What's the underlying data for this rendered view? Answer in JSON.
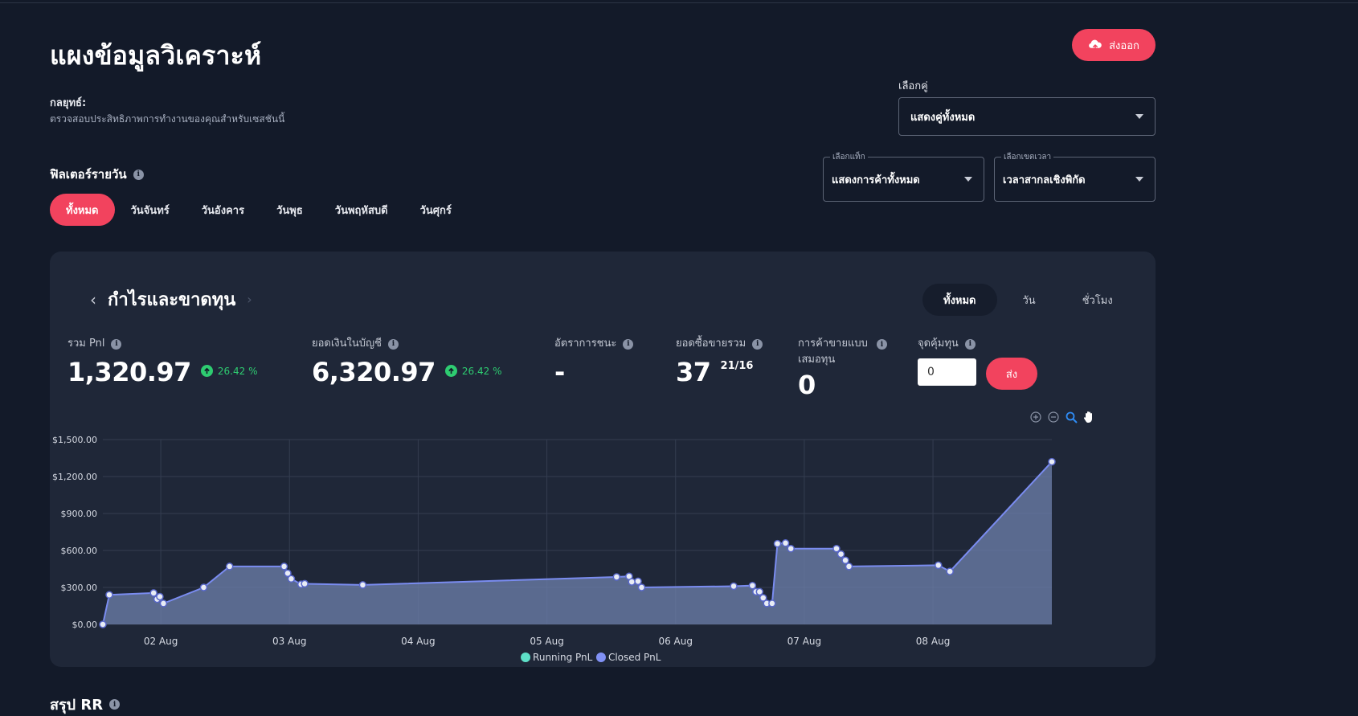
{
  "page": {
    "title": "แผงข้อมูลวิเคราะห์",
    "strategy_label": "กลยุทธ์:",
    "strategy_desc": "ตรวจสอบประสิทธิภาพการทำงานของคุณสำหรับเซสชันนี้",
    "export_label": "ส่งออก"
  },
  "filters": {
    "pair_label": "เลือกคู่",
    "pair_value": "แสดงคู่ทั้งหมด",
    "tag_legend": "เลือกแท็ก",
    "tag_value": "แสดงการค้าทั้งหมด",
    "tz_legend": "เลือกเขตเวลา",
    "tz_value": "เวลาสากลเชิงพิกัด",
    "daily_title": "ฟิลเตอร์รายวัน",
    "days": [
      "ทั้งหมด",
      "วันจันทร์",
      "วันอังคาร",
      "วันพุธ",
      "วันพฤหัสบดี",
      "วันศุกร์"
    ],
    "active_day": 0
  },
  "card": {
    "title": "กำไรและขาดทุน",
    "range_tabs": [
      "ทั้งหมด",
      "วัน",
      "ชั่วโมง"
    ],
    "active_range": 0,
    "stats": {
      "total_pnl": {
        "label": "รวม Pnl",
        "value": "1,320.97",
        "delta": "26.42 %"
      },
      "balance": {
        "label": "ยอดเงินในบัญชี",
        "value": "6,320.97",
        "delta": "26.42 %"
      },
      "win_rate": {
        "label": "อัตราการชนะ",
        "value": "-"
      },
      "total_trades": {
        "label": "ยอดซื้อขายรวม",
        "value": "37",
        "sub": "21/16"
      },
      "breakeven_trades": {
        "label": "การค้าขายแบบเสมอทุน",
        "value": "0"
      },
      "breakeven": {
        "label": "จุดคุ้มทุน",
        "input_value": "0",
        "submit_label": "ส่ง"
      }
    }
  },
  "chart_data": {
    "type": "area",
    "y_tick_labels": [
      "$0.00",
      "$300.00",
      "$600.00",
      "$900.00",
      "$1,200.00",
      "$1,500.00"
    ],
    "x_tick_labels": [
      "02 Aug",
      "03 Aug",
      "04 Aug",
      "05 Aug",
      "06 Aug",
      "07 Aug",
      "08 Aug"
    ],
    "ylim": [
      0,
      1500
    ],
    "grid": true,
    "legend_position": "bottom-center",
    "legend": [
      {
        "name": "Running PnL",
        "color": "#5ee0c8"
      },
      {
        "name": "Closed PnL",
        "color": "#8191f5"
      }
    ],
    "series": [
      {
        "name": "Closed PnL",
        "color": "#7a8cf0",
        "points": [
          [
            "01 Aug 13:12",
            0
          ],
          [
            "01 Aug 14:24",
            240
          ],
          [
            "01 Aug 22:40",
            255
          ],
          [
            "01 Aug 23:20",
            205
          ],
          [
            "01 Aug 23:50",
            225
          ],
          [
            "02 Aug 00:30",
            170
          ],
          [
            "02 Aug 08:00",
            300
          ],
          [
            "02 Aug 12:50",
            470
          ],
          [
            "02 Aug 23:00",
            470
          ],
          [
            "02 Aug 23:40",
            415
          ],
          [
            "03 Aug 00:20",
            370
          ],
          [
            "03 Aug 13:40",
            320
          ],
          [
            "03 Aug 02:10",
            325
          ],
          [
            "03 Aug 02:50",
            330
          ],
          [
            "05 Aug 13:00",
            385
          ],
          [
            "05 Aug 15:20",
            390
          ],
          [
            "05 Aug 15:50",
            345
          ],
          [
            "05 Aug 17:00",
            350
          ],
          [
            "05 Aug 17:40",
            300
          ],
          [
            "06 Aug 10:50",
            310
          ],
          [
            "06 Aug 14:20",
            315
          ],
          [
            "06 Aug 15:00",
            265
          ],
          [
            "06 Aug 15:40",
            265
          ],
          [
            "06 Aug 16:20",
            215
          ],
          [
            "06 Aug 17:00",
            170
          ],
          [
            "06 Aug 18:00",
            170
          ],
          [
            "06 Aug 19:00",
            655
          ],
          [
            "06 Aug 20:30",
            660
          ],
          [
            "06 Aug 21:30",
            615
          ],
          [
            "07 Aug 06:00",
            615
          ],
          [
            "07 Aug 06:50",
            570
          ],
          [
            "07 Aug 07:40",
            520
          ],
          [
            "07 Aug 08:20",
            470
          ],
          [
            "08 Aug 01:00",
            480
          ],
          [
            "08 Aug 03:10",
            430
          ],
          [
            "08 Aug 22:10",
            1320
          ]
        ]
      }
    ]
  },
  "summary": {
    "rr_title": "สรุป RR"
  }
}
